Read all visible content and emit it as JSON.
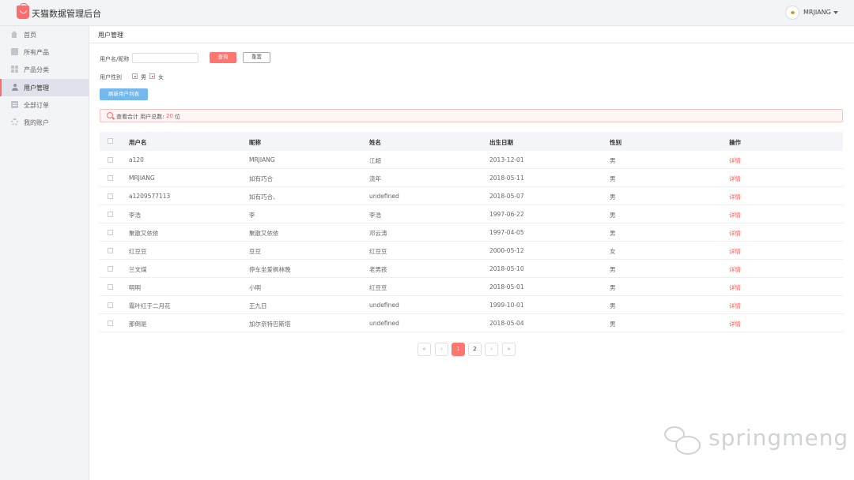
{
  "app": {
    "title": "天猫数据管理后台"
  },
  "user": {
    "name": "MRJIANG"
  },
  "sidebar": {
    "items": [
      {
        "label": "首页",
        "icon": "home-icon"
      },
      {
        "label": "所有产品",
        "icon": "product-icon"
      },
      {
        "label": "产品分类",
        "icon": "category-icon"
      },
      {
        "label": "用户管理",
        "icon": "user-icon",
        "active": true
      },
      {
        "label": "全部订单",
        "icon": "order-icon"
      },
      {
        "label": "我的账户",
        "icon": "gear-icon"
      }
    ]
  },
  "breadcrumb": {
    "current": "用户管理"
  },
  "filters": {
    "name_label": "用户名/昵称",
    "name_value": "",
    "name_placeholder": "",
    "search_label": "查询",
    "reset_label": "重置",
    "gender_label": "用户性别",
    "gender_options": [
      {
        "label": "男",
        "checked": true
      },
      {
        "label": "女",
        "checked": true
      }
    ],
    "refresh_label": "刷新用户列表"
  },
  "summary": {
    "prefix": "查看合计  用户总数:",
    "count": "20",
    "unit": "位"
  },
  "table": {
    "headers": [
      "用户名",
      "昵称",
      "姓名",
      "出生日期",
      "性别",
      "操作"
    ],
    "rows": [
      {
        "username": "a120",
        "nickname": "MRJIANG",
        "realname": "江超",
        "birthday": "2013-12-01",
        "gender": "男",
        "action": "详情"
      },
      {
        "username": "MRJIANG",
        "nickname": "如有巧合",
        "realname": "流年",
        "birthday": "2018-05-11",
        "gender": "男",
        "action": "详情"
      },
      {
        "username": "a1209577113",
        "nickname": "如有巧合、",
        "realname": "undefined",
        "birthday": "2018-05-07",
        "gender": "男",
        "action": "详情"
      },
      {
        "username": "李浩",
        "nickname": "李",
        "realname": "李浩",
        "birthday": "1997-06-22",
        "gender": "男",
        "action": "详情"
      },
      {
        "username": "聚散又依依",
        "nickname": "聚散又依依",
        "realname": "邓云涛",
        "birthday": "1997-04-05",
        "gender": "男",
        "action": "详情"
      },
      {
        "username": "红豆豆",
        "nickname": "豆豆",
        "realname": "红豆豆",
        "birthday": "2000-05-12",
        "gender": "女",
        "action": "详情"
      },
      {
        "username": "兰文煤",
        "nickname": "停车坐爱枫林晚",
        "realname": "老男孩",
        "birthday": "2018-05-10",
        "gender": "男",
        "action": "详情"
      },
      {
        "username": "明明",
        "nickname": "小明",
        "realname": "红豆豆",
        "birthday": "2018-05-01",
        "gender": "男",
        "action": "详情"
      },
      {
        "username": "霜叶红于二月花",
        "nickname": "王九日",
        "realname": "undefined",
        "birthday": "1999-10-01",
        "gender": "男",
        "action": "详情"
      },
      {
        "username": "那倒是",
        "nickname": "加尔奈特巴斯塔",
        "realname": "undefined",
        "birthday": "2018-05-04",
        "gender": "男",
        "action": "详情"
      }
    ]
  },
  "pagination": {
    "first": "«",
    "prev": "‹",
    "pages": [
      "1",
      "2"
    ],
    "current": "1",
    "next": "›",
    "last": "»"
  },
  "watermark": {
    "text": "springmeng"
  },
  "colors": {
    "accent": "#ff7570",
    "link": "#ff5a52",
    "refresh": "#74b8f0"
  }
}
